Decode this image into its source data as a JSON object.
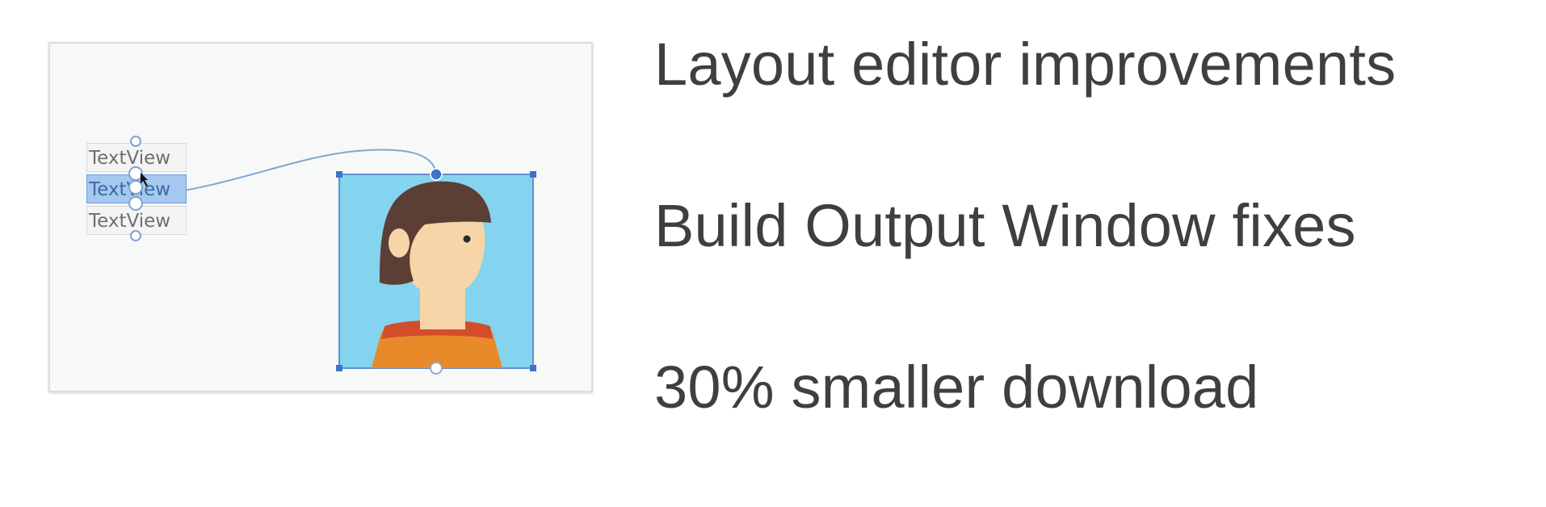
{
  "editor": {
    "textviews": [
      {
        "label": "TextView",
        "selected": false
      },
      {
        "label": "TextView",
        "selected": true
      },
      {
        "label": "TextView",
        "selected": false
      }
    ],
    "colors": {
      "selection": "#a6c8ef",
      "handle": "#3d73c8",
      "image_background": "#84d3ef",
      "hair": "#5b3f35",
      "skin": "#f6d6a8",
      "shirt": "#e88a2a",
      "collar": "#d44d2a",
      "connector": "#7aa9d6"
    }
  },
  "features": [
    "Layout editor improvements",
    "Build Output Window fixes",
    "30% smaller download"
  ]
}
